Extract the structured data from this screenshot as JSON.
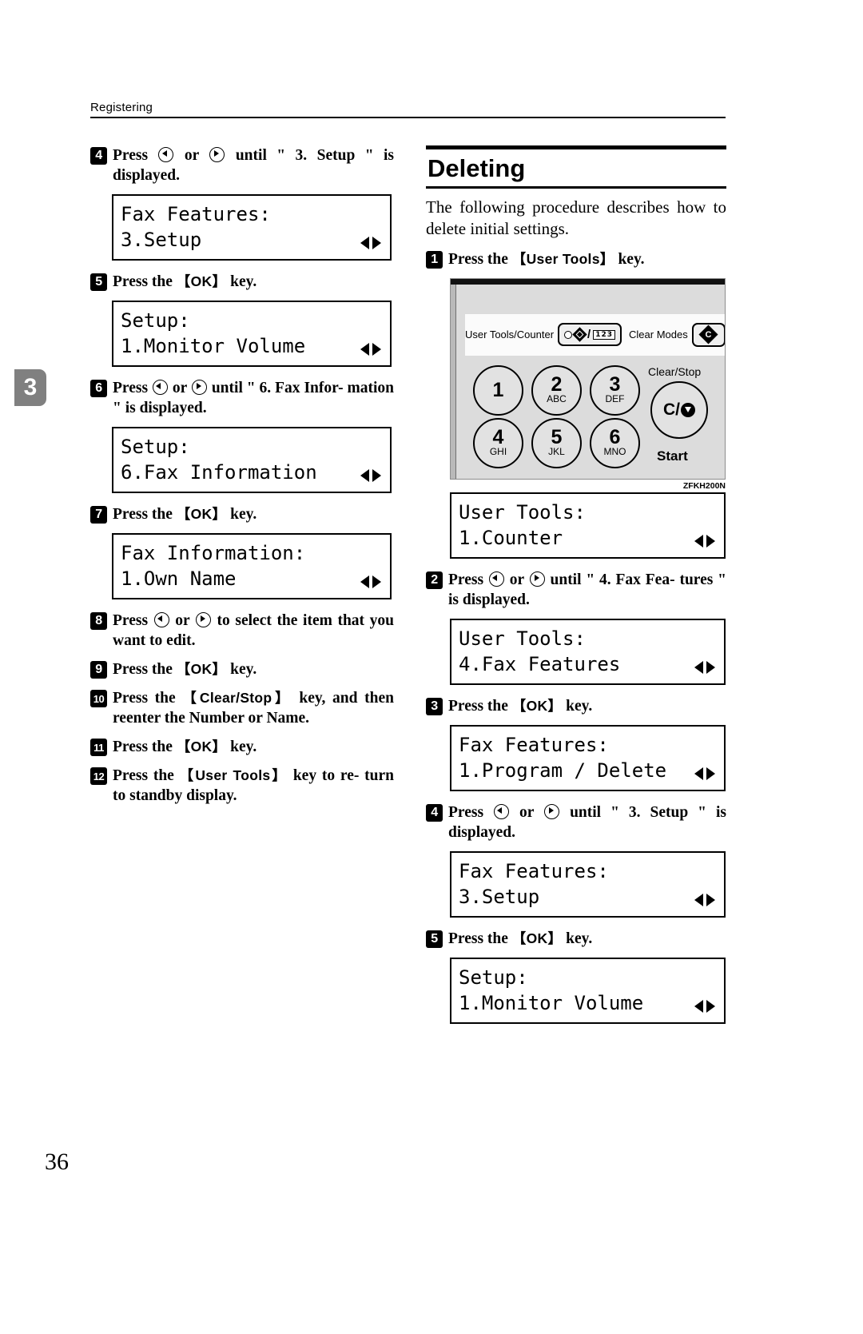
{
  "header": {
    "running_head": "Registering",
    "chapter_tab": "3"
  },
  "footer": {
    "page_number": "36"
  },
  "left_column": {
    "steps": [
      {
        "num": "4",
        "text_parts": [
          "Press ",
          "LEFT",
          " or ",
          "RIGHT",
          " until \" 3. Setup \" is displayed."
        ],
        "text_plain": "Press  or  until \" 3. Setup \" is displayed.",
        "lcd": {
          "line1": "Fax Features:",
          "line2": "3.Setup"
        }
      },
      {
        "num": "5",
        "text_plain": "Press the OK key.",
        "key": "OK",
        "lcd": {
          "line1": "Setup:",
          "line2": "1.Monitor Volume"
        }
      },
      {
        "num": "6",
        "text_plain": "Press  or  until \" 6. Fax Information \" is displayed.",
        "lcd": {
          "line1": "Setup:",
          "line2": "6.Fax Information"
        }
      },
      {
        "num": "7",
        "text_plain": "Press the OK key.",
        "key": "OK",
        "lcd": {
          "line1": "Fax Information:",
          "line2": "1.Own Name"
        }
      },
      {
        "num": "8",
        "text_plain": "Press  or  to select the item that you want to edit."
      },
      {
        "num": "9",
        "text_plain": "Press the OK key.",
        "key": "OK"
      },
      {
        "num": "10",
        "text_plain": "Press the Clear/Stop key, and then reenter the Number or Name.",
        "key": "Clear/Stop"
      },
      {
        "num": "11",
        "text_plain": "Press the OK key.",
        "key": "OK"
      },
      {
        "num": "12",
        "text_plain": "Press the User Tools key to return to standby display.",
        "key": "User Tools"
      }
    ],
    "fragments": {
      "press": "Press ",
      "or": " or ",
      "until_3_setup": " until \" 3. Setup \" is",
      "displayed": "displayed.",
      "press_the": "Press the ",
      "key_period": " key.",
      "ok": "OK",
      "until_6_fax": " until \" 6. Fax Infor-",
      "mation_displayed": "mation \" is displayed.",
      "to_select": " to select the item",
      "that_you_want": "that you want to edit.",
      "clear_stop": "Clear/Stop",
      "key_and": " key, and",
      "then_reenter": "then reenter the Number or",
      "name": "Name.",
      "user_tools": "User Tools",
      "key_to_re": " key to re-",
      "turn_standby": "turn to standby display."
    }
  },
  "right_column": {
    "section": {
      "title": "Deleting",
      "intro": "The following procedure describes how to delete initial settings."
    },
    "figure": {
      "user_tools_counter_label": "User Tools/Counter",
      "clear_modes_label": "Clear Modes",
      "clear_stop_label": "Clear/Stop",
      "clear_stop_key": "C/",
      "start_label": "Start",
      "code": "ZFKH200N",
      "numeric_keys": [
        {
          "number": "1",
          "letters": ""
        },
        {
          "number": "2",
          "letters": "ABC"
        },
        {
          "number": "3",
          "letters": "DEF"
        },
        {
          "number": "4",
          "letters": "GHI"
        },
        {
          "number": "5",
          "letters": "JKL"
        },
        {
          "number": "6",
          "letters": "MNO"
        }
      ],
      "key_123": "123"
    },
    "steps": [
      {
        "num": "1",
        "text_plain": "Press the User Tools key.",
        "key": "User Tools",
        "lcd": {
          "line1": "User Tools:",
          "line2": "1.Counter"
        }
      },
      {
        "num": "2",
        "text_plain": "Press  or  until \" 4. Fax Features \" is displayed.",
        "lcd": {
          "line1": "User Tools:",
          "line2": "4.Fax Features"
        }
      },
      {
        "num": "3",
        "text_plain": "Press the OK key.",
        "key": "OK",
        "lcd": {
          "line1": "Fax Features:",
          "line2": "1.Program / Delete"
        }
      },
      {
        "num": "4",
        "text_plain": "Press  or  until \" 3. Setup \" is displayed.",
        "lcd": {
          "line1": "Fax Features:",
          "line2": "3.Setup"
        }
      },
      {
        "num": "5",
        "text_plain": "Press the OK key.",
        "key": "OK",
        "lcd": {
          "line1": "Setup:",
          "line2": "1.Monitor Volume"
        }
      }
    ],
    "fragments": {
      "press_the": "Press the ",
      "user_tools": "User Tools",
      "key_period": " key.",
      "press": "Press ",
      "or": " or ",
      "until_4_fax": " until \" 4. Fax Fea-",
      "tures_displayed": "tures \" is displayed.",
      "ok": "OK",
      "until_3_setup": " until \" 3. Setup \" is",
      "displayed": "displayed."
    }
  }
}
